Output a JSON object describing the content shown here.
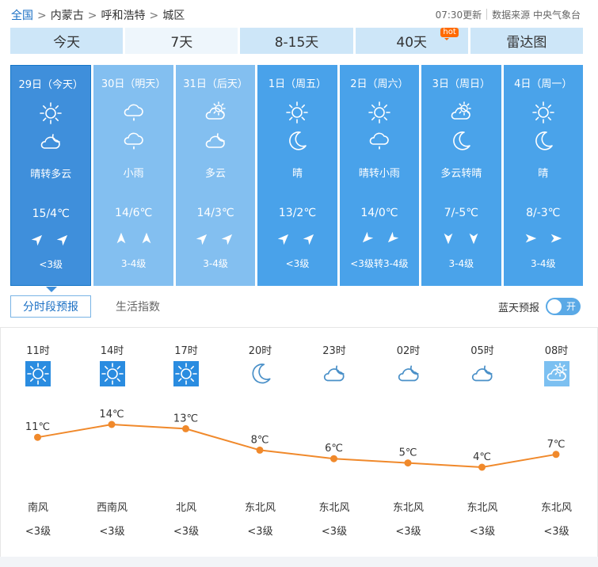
{
  "breadcrumb": {
    "home": "全国",
    "province": "内蒙古",
    "city": "呼和浩特",
    "district": "城区",
    "separator": ">"
  },
  "update": {
    "time": "07:30更新",
    "source": "数据来源 中央气象台"
  },
  "tabs": [
    {
      "label": "今天",
      "active": false
    },
    {
      "label": "7天",
      "active": true
    },
    {
      "label": "8-15天",
      "active": false
    },
    {
      "label": "40天",
      "active": false,
      "badge": "hot"
    },
    {
      "label": "雷达图",
      "active": false
    }
  ],
  "days": [
    {
      "date": "29日（今天）",
      "icon_day": "sun-icon",
      "icon_night": "cloudy-night-icon",
      "weather": "晴转多云",
      "temp": "15/4℃",
      "wind_day": "northeast-wind-icon",
      "wind_night": "northeast-wind-icon",
      "level": "<3级",
      "bg": "#3f8fdb",
      "selected": true
    },
    {
      "date": "30日（明天）",
      "icon_day": "rain-icon",
      "icon_night": "rain-icon",
      "weather": "小雨",
      "temp": "14/6℃",
      "wind_day": "north-wind-icon",
      "wind_night": "north-wind-icon",
      "level": "3-4级",
      "bg": "#83bff0",
      "selected": false
    },
    {
      "date": "31日（后天）",
      "icon_day": "partly-cloudy-icon",
      "icon_night": "cloudy-night-icon",
      "weather": "多云",
      "temp": "14/3℃",
      "wind_day": "northeast-wind-icon",
      "wind_night": "northeast-wind-icon",
      "level": "3-4级",
      "bg": "#83bff0",
      "selected": false
    },
    {
      "date": "1日（周五）",
      "icon_day": "sun-icon",
      "icon_night": "moon-icon",
      "weather": "晴",
      "temp": "13/2℃",
      "wind_day": "northeast-wind-icon",
      "wind_night": "northeast-wind-icon",
      "level": "<3级",
      "bg": "#49a2ea",
      "selected": false
    },
    {
      "date": "2日（周六）",
      "icon_day": "sun-icon",
      "icon_night": "rain-icon",
      "weather": "晴转小雨",
      "temp": "14/0℃",
      "wind_day": "southwest-wind-icon",
      "wind_night": "southwest-wind-icon",
      "level": "<3级转3-4级",
      "bg": "#49a2ea",
      "selected": false
    },
    {
      "date": "3日（周日）",
      "icon_day": "partly-cloudy-icon",
      "icon_night": "moon-icon",
      "weather": "多云转晴",
      "temp": "7/-5℃",
      "wind_day": "south-wind-icon",
      "wind_night": "south-wind-icon",
      "level": "3-4级",
      "bg": "#4aa3ea",
      "selected": false
    },
    {
      "date": "4日（周一）",
      "icon_day": "sun-icon",
      "icon_night": "moon-icon",
      "weather": "晴",
      "temp": "8/-3℃",
      "wind_day": "east-wind-icon",
      "wind_night": "east-wind-icon",
      "level": "3-4级",
      "bg": "#4aa3ea",
      "selected": false
    }
  ],
  "subtabs": [
    {
      "label": "分时段预报",
      "active": true
    },
    {
      "label": "生活指数",
      "active": false
    }
  ],
  "bluesky": {
    "label": "蓝天预报",
    "toggle_text": "开"
  },
  "hourly": [
    {
      "time": "11时",
      "icon": "sun-square-icon",
      "temp": 11,
      "temp_label": "11℃",
      "dir": "南风",
      "level": "<3级"
    },
    {
      "time": "14时",
      "icon": "sun-square-icon",
      "temp": 14,
      "temp_label": "14℃",
      "dir": "西南风",
      "level": "<3级"
    },
    {
      "time": "17时",
      "icon": "sun-square-icon",
      "temp": 13,
      "temp_label": "13℃",
      "dir": "北风",
      "level": "<3级"
    },
    {
      "time": "20时",
      "icon": "moon-icon",
      "temp": 8,
      "temp_label": "8℃",
      "dir": "东北风",
      "level": "<3级"
    },
    {
      "time": "23时",
      "icon": "cloudy-night-icon",
      "temp": 6,
      "temp_label": "6℃",
      "dir": "东北风",
      "level": "<3级"
    },
    {
      "time": "02时",
      "icon": "cloudy-night-icon",
      "temp": 5,
      "temp_label": "5℃",
      "dir": "东北风",
      "level": "<3级"
    },
    {
      "time": "05时",
      "icon": "cloudy-night-icon",
      "temp": 4,
      "temp_label": "4℃",
      "dir": "东北风",
      "level": "<3级"
    },
    {
      "time": "08时",
      "icon": "partly-cloudy-square-icon",
      "temp": 7,
      "temp_label": "7℃",
      "dir": "东北风",
      "level": "<3级"
    }
  ],
  "colors": {
    "accent": "#1a6fc4",
    "line": "#f0892b",
    "tab_bg": "#cde6f8",
    "tab_active_bg": "#eef6fc"
  }
}
